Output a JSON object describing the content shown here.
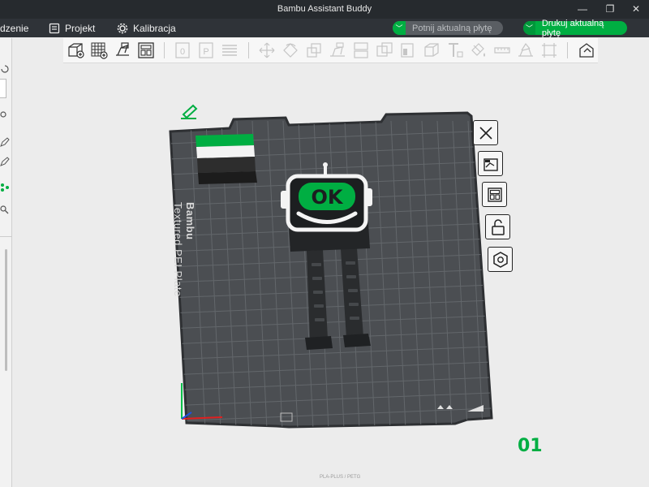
{
  "window": {
    "title": "Bambu Assistant Buddy",
    "minimize": "—",
    "restore": "❐",
    "close": "✕"
  },
  "menubar": {
    "items": [
      {
        "label": "dzenie",
        "icon": "device-icon"
      },
      {
        "label": "Projekt",
        "icon": "project-icon"
      },
      {
        "label": "Kalibracja",
        "icon": "calibration-icon"
      }
    ],
    "slice_button": "Potnij aktualną płytę",
    "print_button": "Drukuj aktualną płytę"
  },
  "toolbar": {
    "icons": [
      "add-cube-icon",
      "grid-add-icon",
      "auto-orient-icon",
      "arrange-icon",
      "plate-0-icon",
      "plate-p-icon",
      "layers-icon",
      "move-icon",
      "rotate-icon",
      "scale-icon",
      "lay-on-face-icon",
      "split-icon",
      "boolean-icon",
      "cut-icon",
      "mesh-icon",
      "text-icon",
      "paint-icon",
      "measure-icon",
      "assembly-icon",
      "fit-icon",
      "undo-icon"
    ]
  },
  "plate": {
    "number": "01",
    "label_line1": "Bambu",
    "label_line2": "Textured PEI Plate",
    "foot_text": "PLA-PLUS / PETG"
  },
  "side_tools": [
    "close-plate-icon",
    "auto-orient-plate-icon",
    "arrange-plate-icon",
    "lock-plate-icon",
    "plate-settings-icon"
  ],
  "colors": {
    "accent": "#00ae42",
    "plate": "#4a4d50",
    "grid": "#606468",
    "model": "#2a2c2e"
  },
  "model": {
    "face_text": "OK"
  }
}
